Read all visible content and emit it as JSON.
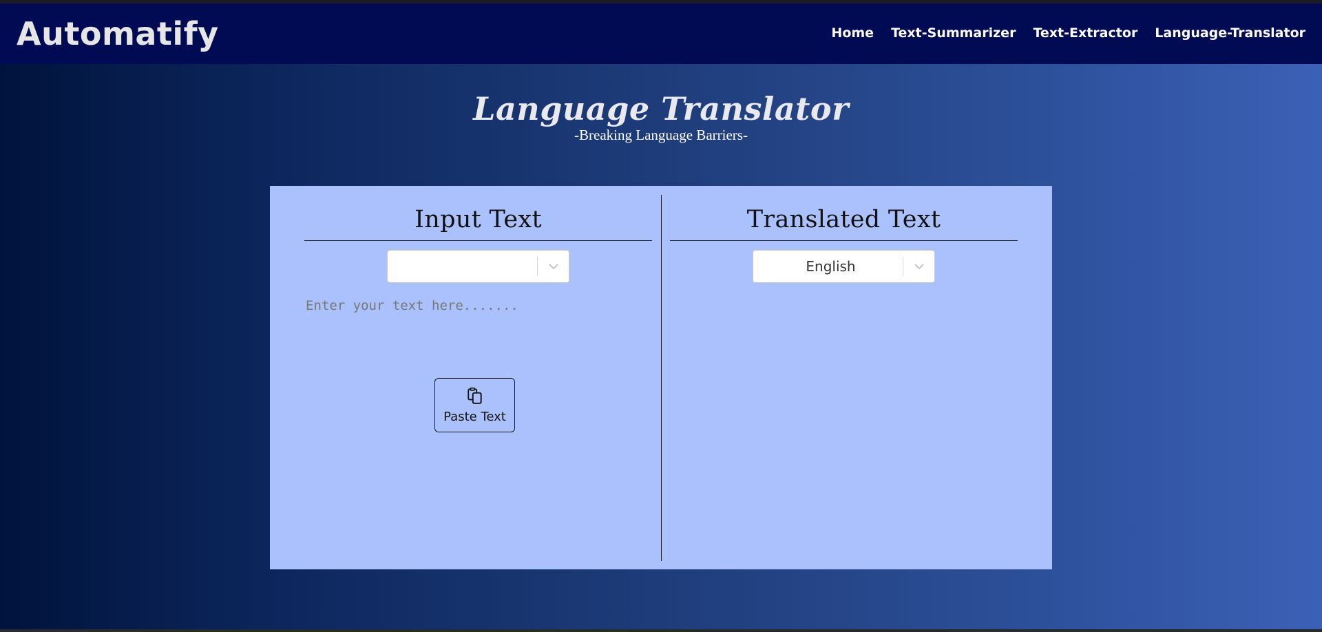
{
  "navbar": {
    "brand": "Automatify",
    "links": [
      "Home",
      "Text-Summarizer",
      "Text-Extractor",
      "Language-Translator"
    ]
  },
  "hero": {
    "title": "Language Translator",
    "subtitle": "-Breaking Language Barriers-"
  },
  "input_panel": {
    "heading": "Input Text",
    "language_value": "",
    "placeholder": "Enter your text here.......",
    "paste_label": "Paste Text",
    "paste_icon": "clipboard-icon"
  },
  "output_panel": {
    "heading": "Translated Text",
    "language_value": "English"
  },
  "colors": {
    "navbar": "#000b54",
    "panel": "#abc1fd",
    "brand_text": "#e6e6e6"
  }
}
